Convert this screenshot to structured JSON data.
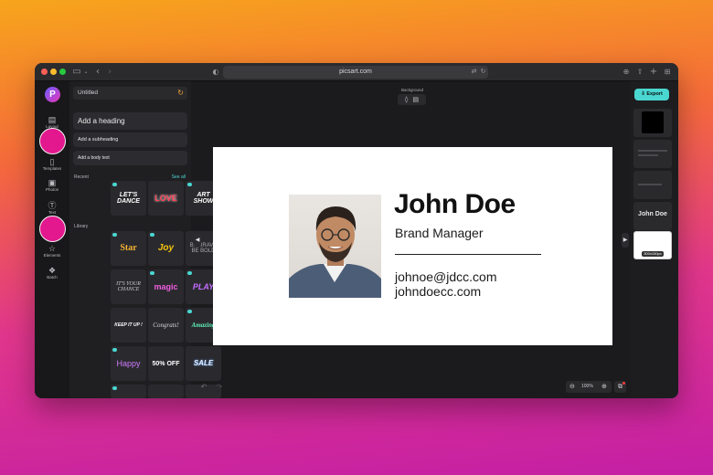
{
  "browser": {
    "url": "picsart.com"
  },
  "app": {
    "logo_letter": "P",
    "document_title": "Untitled"
  },
  "rail": {
    "items": [
      {
        "label": "Layout",
        "icon": "layout-icon"
      },
      {
        "label": "Templates",
        "icon": "templates-icon"
      },
      {
        "label": "Photos",
        "icon": "photos-icon"
      },
      {
        "label": "Text",
        "icon": "text-icon"
      },
      {
        "label": "Elements",
        "icon": "elements-icon"
      },
      {
        "label": "Batch",
        "icon": "batch-icon"
      }
    ]
  },
  "text_panel": {
    "heading_button": "Add a heading",
    "subheading_button": "Add a subheading",
    "body_button": "Add a body text",
    "recent_label": "Recent",
    "see_all": "See all",
    "library_label": "Library",
    "recent_tiles": [
      "LET'S DANCE",
      "LOVE",
      "ART SHOW"
    ],
    "library_tiles": [
      "Star",
      "Joy",
      "BE BRAVE BE BOLD",
      "IT'S YOUR CHANCE",
      "magic",
      "PLAY",
      "KEEP IT UP !",
      "Congrats!",
      "Amazing",
      "Happy",
      "50% OFF",
      "SALE"
    ]
  },
  "canvas": {
    "background_label": "Background",
    "card": {
      "name": "John Doe",
      "role": "Brand Manager",
      "email": "johnoe@jdcc.com",
      "website": "johndoecc.com"
    },
    "zoom": "100%"
  },
  "right_panel": {
    "export_label": "Export",
    "thumb_text": "John Doe",
    "thumb_size_label": "300x150px"
  },
  "colors": {
    "accent": "#4ad7d1",
    "brand_gradient_start": "#6a5cff",
    "brand_gradient_end": "#e836b7",
    "highlight_circle": "#e3188e"
  }
}
